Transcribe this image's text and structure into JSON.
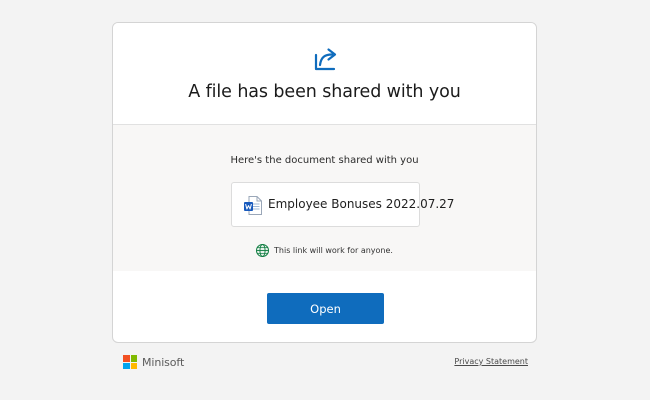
{
  "dialog": {
    "title": "A file has been shared with you",
    "subtitle": "Here's the document shared with you",
    "file_name": "Employee Bonuses 2022.07.27",
    "file_icon": "word-document-icon",
    "share_icon": "share-arrow-icon",
    "link_note": "This link will work for anyone.",
    "link_note_icon": "globe-icon",
    "open_label": "Open"
  },
  "footer": {
    "brand": "Minisoft",
    "privacy_label": "Privacy Statement"
  },
  "colors": {
    "accent": "#0f6cbd",
    "background": "#f3f3f3",
    "logo_red": "#f25022",
    "logo_green": "#7fba00",
    "logo_blue": "#00a4ef",
    "logo_yellow": "#ffb900",
    "globe_green": "#107c41"
  }
}
